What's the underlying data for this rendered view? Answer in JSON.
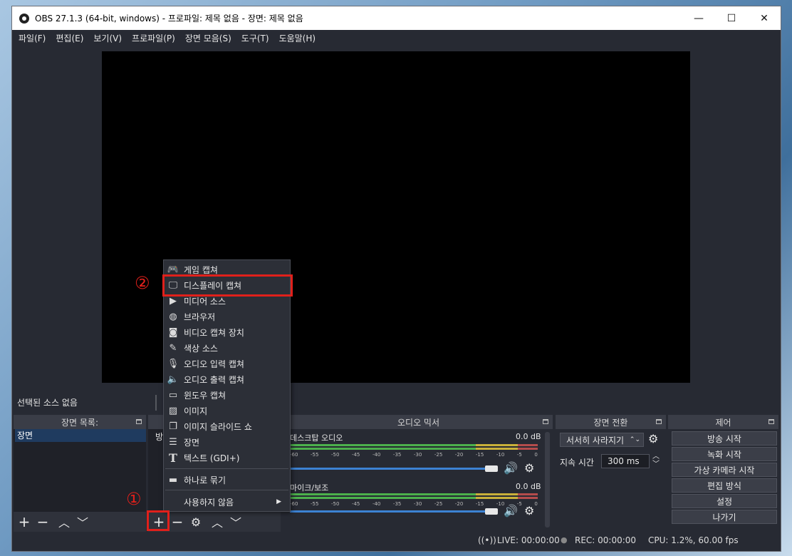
{
  "window": {
    "title": "OBS 27.1.3 (64-bit, windows) - 프로파일: 제목 없음 - 장면: 제목 없음",
    "minimize": "—",
    "maximize": "☐",
    "close": "✕"
  },
  "menu": [
    "파일(F)",
    "편집(E)",
    "보기(V)",
    "프로파일(P)",
    "장면 모음(S)",
    "도구(T)",
    "도움말(H)"
  ],
  "source_bar": {
    "label": "선택된 소스 없음"
  },
  "scenes": {
    "title": "장면 목록:",
    "items": [
      "장면"
    ]
  },
  "sources": {
    "partial_label": "방"
  },
  "audio_mixer": {
    "title": "오디오 믹서",
    "channels": [
      {
        "name": "데스크탑 오디오",
        "db": "0.0 dB"
      },
      {
        "name": "마이크/보조",
        "db": "0.0 dB"
      }
    ],
    "ticks": [
      "-60",
      "-55",
      "-50",
      "-45",
      "-40",
      "-35",
      "-30",
      "-25",
      "-20",
      "-15",
      "-10",
      "-5",
      "0"
    ]
  },
  "transitions": {
    "title": "장면 전환",
    "selected": "서서히 사라지기",
    "duration_label": "지속 시간",
    "duration_value": "300 ms"
  },
  "controls": {
    "title": "제어",
    "buttons": [
      "방송 시작",
      "녹화 시작",
      "가상 카메라 시작",
      "편집 방식",
      "설정",
      "나가기"
    ]
  },
  "status": {
    "live": "LIVE: 00:00:00",
    "rec": "REC: 00:00:00",
    "cpu": "CPU: 1.2%, 60.00 fps"
  },
  "context_menu": {
    "items": [
      {
        "label": "게임 캡쳐",
        "icon": "gamepad-icon"
      },
      {
        "label": "디스플레이 캡쳐",
        "icon": "monitor-icon"
      },
      {
        "label": "미디어 소스",
        "icon": "play-icon"
      },
      {
        "label": "브라우저",
        "icon": "globe-icon"
      },
      {
        "label": "비디오 캡쳐 장치",
        "icon": "camera-icon"
      },
      {
        "label": "색상 소스",
        "icon": "brush-icon"
      },
      {
        "label": "오디오 입력 캡쳐",
        "icon": "microphone-icon"
      },
      {
        "label": "오디오 출력 캡쳐",
        "icon": "speaker-icon"
      },
      {
        "label": "윈도우 캡쳐",
        "icon": "window-icon"
      },
      {
        "label": "이미지",
        "icon": "image-icon"
      },
      {
        "label": "이미지 슬라이드 쇼",
        "icon": "slideshow-icon"
      },
      {
        "label": "장면",
        "icon": "list-icon"
      },
      {
        "label": "텍스트 (GDI+)",
        "icon": "text-icon"
      }
    ],
    "group": "하나로 묶기",
    "deprecated": "사용하지 않음"
  },
  "annotations": {
    "step1": "①",
    "step2": "②",
    "highlight_color": "#e0201b"
  }
}
